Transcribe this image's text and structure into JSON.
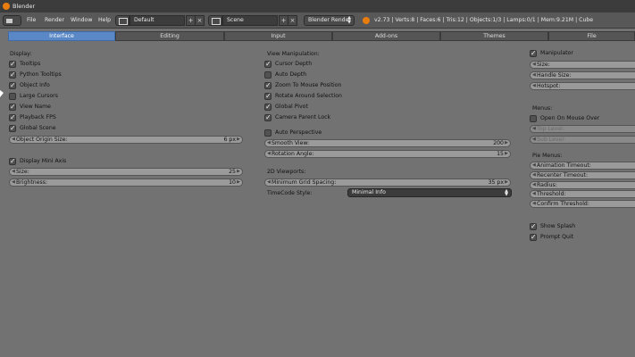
{
  "window": {
    "title": "Blender"
  },
  "header": {
    "menus": [
      "File",
      "Render",
      "Window",
      "Help"
    ],
    "screen_layout": "Default",
    "scene": "Scene",
    "engine": "Blender Render",
    "stats": "v2.73 | Verts:8 | Faces:6 | Tris:12 | Objects:1/3 | Lamps:0/1 | Mem:9.21M | Cube"
  },
  "tabs": [
    "Interface",
    "Editing",
    "Input",
    "Add-ons",
    "Themes",
    "File"
  ],
  "left": {
    "display_label": "Display:",
    "checks": [
      {
        "label": "Tooltips",
        "checked": true
      },
      {
        "label": "Python Tooltips",
        "checked": true
      },
      {
        "label": "Object Info",
        "checked": true
      },
      {
        "label": "Large Cursors",
        "checked": false
      },
      {
        "label": "View Name",
        "checked": true
      },
      {
        "label": "Playback FPS",
        "checked": true
      },
      {
        "label": "Global Scene",
        "checked": true
      }
    ],
    "origin_size": {
      "label": "Object Origin Size:",
      "value": "6 px"
    },
    "mini_axis": {
      "label": "Display Mini Axis",
      "checked": true
    },
    "size": {
      "label": "Size:",
      "value": "25"
    },
    "brightness": {
      "label": "Brightness:",
      "value": "10"
    }
  },
  "middle": {
    "view_label": "View Manipulation:",
    "checks": [
      {
        "label": "Cursor Depth",
        "checked": true
      },
      {
        "label": "Auto Depth",
        "checked": false
      },
      {
        "label": "Zoom To Mouse Position",
        "checked": true
      },
      {
        "label": "Rotate Around Selection",
        "checked": true
      },
      {
        "label": "Global Pivot",
        "checked": true
      },
      {
        "label": "Camera Parent Lock",
        "checked": true
      }
    ],
    "auto_perspective": {
      "label": "Auto Perspective",
      "checked": false
    },
    "smooth_view": {
      "label": "Smooth View:",
      "value": "200"
    },
    "rotation_angle": {
      "label": "Rotation Angle:",
      "value": "15"
    },
    "viewports_label": "2D Viewports:",
    "grid_spacing": {
      "label": "Minimum Grid Spacing:",
      "value": "35 px"
    },
    "timecode_label": "TimeCode Style:",
    "timecode_value": "Minimal Info"
  },
  "right": {
    "manipulator": {
      "label": "Manipulator",
      "checked": true
    },
    "manip_fields": [
      "Size:",
      "Handle Size:",
      "Hotspot:"
    ],
    "menus_label": "Menus:",
    "open_on_hover": {
      "label": "Open On Mouse Over",
      "checked": false
    },
    "level_fields": [
      "Top Level:",
      "Sub Level:"
    ],
    "pie_label": "Pie Menus:",
    "pie_fields": [
      "Animation Timeout:",
      "Recenter Timeout:",
      "Radius:",
      "Threshold:",
      "Confirm Threshold:"
    ],
    "show_splash": {
      "label": "Show Splash",
      "checked": true
    },
    "prompt_quit": {
      "label": "Prompt Quit",
      "checked": true
    }
  }
}
